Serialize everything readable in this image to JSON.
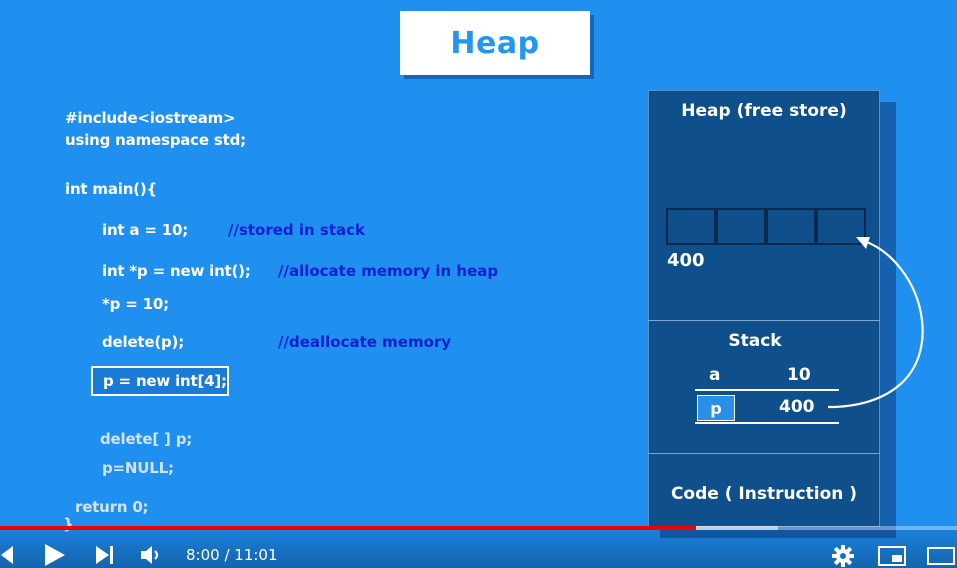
{
  "title": "Heap",
  "code": {
    "line_include": "#include<iostream>",
    "line_using": "using namespace std;",
    "line_main": "int main(){",
    "line_int_a": "int a = 10;",
    "comment_stack": "//stored in stack",
    "line_new_int": "int *p = new int();",
    "comment_heap": "//allocate memory in heap",
    "line_assign": "*p = 10;",
    "line_delete": "delete(p);",
    "comment_dealloc": "//deallocate memory",
    "line_new_array": "p = new int[4];",
    "line_delete_array": "delete[ ] p;",
    "line_null": "p=NULL;",
    "line_return": "return 0;",
    "line_close": "}"
  },
  "memory": {
    "heap_label": "Heap (free store)",
    "heap_address": "400",
    "stack_label": "Stack",
    "var_a_name": "a",
    "var_a_value": "10",
    "var_p_name": "p",
    "var_p_value": "400",
    "code_label": "Code ( Instruction )"
  },
  "player": {
    "time_display": "8:00 / 11:01",
    "progress": 0.727,
    "icons": {
      "previous": "skip-previous-icon",
      "play": "play-icon",
      "next": "skip-next-icon",
      "volume": "volume-icon",
      "settings": "gear-icon",
      "miniplayer": "miniplayer-icon",
      "theater": "theater-mode-icon"
    }
  },
  "colors": {
    "background": "#1f8ff0",
    "title_text": "#2196f3",
    "comment": "#0d1fcf",
    "panel": "#0f4f8c",
    "progress": "#f00000"
  }
}
